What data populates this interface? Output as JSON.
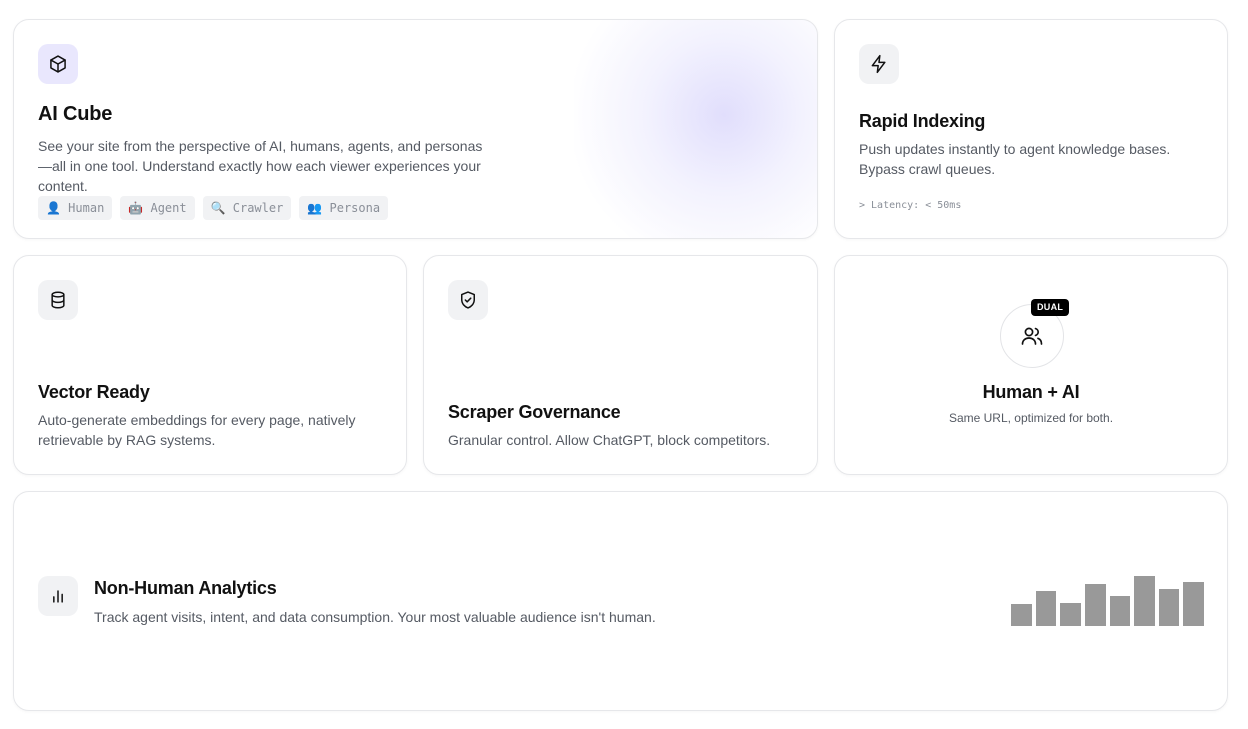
{
  "cube": {
    "title": "AI Cube",
    "desc": "See your site from the perspective of AI, humans, agents, and personas—all in one tool. Understand exactly how each viewer experiences your content.",
    "tags": [
      "👤 Human",
      "🤖 Agent",
      "🔍 Crawler",
      "👥 Persona"
    ],
    "icon": "cube-icon",
    "accent": "#e9e7fd"
  },
  "rapid": {
    "title": "Rapid Indexing",
    "desc": "Push updates instantly to agent knowledge bases. Bypass crawl queues.",
    "note": "> Latency: < 50ms",
    "icon": "lightning-icon"
  },
  "vector": {
    "title": "Vector Ready",
    "desc": "Auto-generate embeddings for every page, natively retrievable by RAG systems.",
    "icon": "database-icon"
  },
  "scraper": {
    "title": "Scraper Governance",
    "desc": "Granular control. Allow ChatGPT, block competitors.",
    "icon": "shield-check-icon"
  },
  "human": {
    "title": "Human + AI",
    "desc": "Same URL, optimized for both.",
    "badge": "DUAL",
    "icon": "users-icon"
  },
  "analytics": {
    "title": "Non-Human Analytics",
    "desc": "Track agent visits, intent, and data consumption. Your most valuable audience isn't human.",
    "icon": "bar-chart-icon",
    "bar_levels": [
      0.4,
      0.65,
      0.42,
      0.78,
      0.55,
      0.92,
      0.68,
      0.82
    ],
    "bar_color": "#999999"
  }
}
